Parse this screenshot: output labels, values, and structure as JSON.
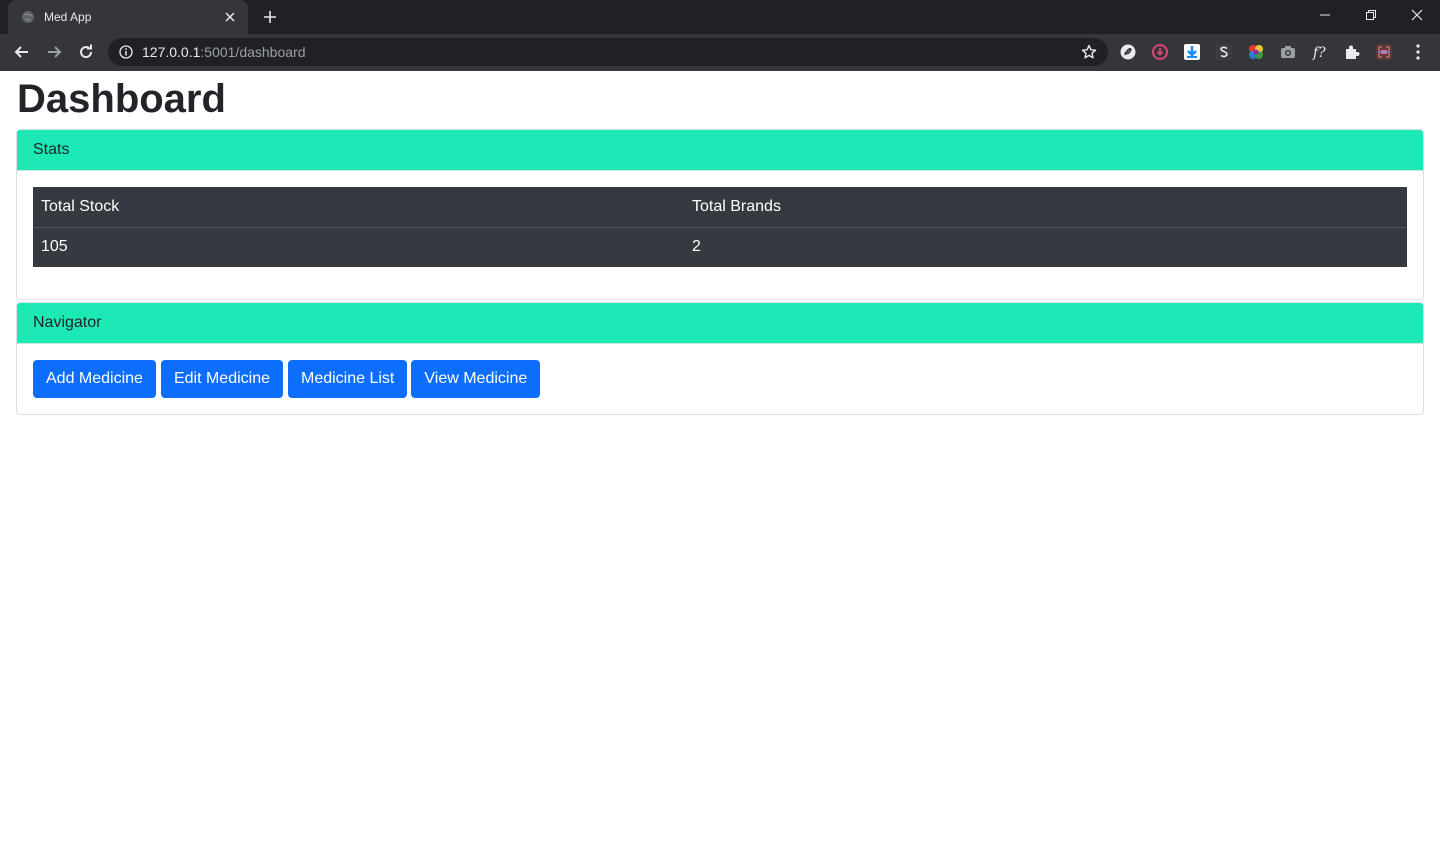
{
  "browser": {
    "tab_title": "Med App",
    "url_host": "127.0.0.1",
    "url_rest": ":5001/dashboard",
    "colors": {
      "tabstrip": "#202124",
      "toolbar": "#35363a"
    },
    "extensions": [
      "s-circle-ext-icon",
      "download-red-ext-icon",
      "download-blue-ext-icon",
      "s-letter-ext-icon",
      "color-wheel-ext-icon",
      "camera-ext-icon",
      "function-ext-icon",
      "puzzle-icon",
      "profile-ext-icon"
    ]
  },
  "page": {
    "title": "Dashboard",
    "stats": {
      "header": "Stats",
      "columns": [
        "Total Stock",
        "Total Brands"
      ],
      "rows": [
        [
          "105",
          "2"
        ]
      ]
    },
    "navigator": {
      "header": "Navigator",
      "buttons": [
        "Add Medicine",
        "Edit Medicine",
        "Medicine List",
        "View Medicine"
      ]
    },
    "colors": {
      "card_header": "#1de9b6",
      "table_bg": "#343a40",
      "button": "#0d6efd"
    }
  }
}
